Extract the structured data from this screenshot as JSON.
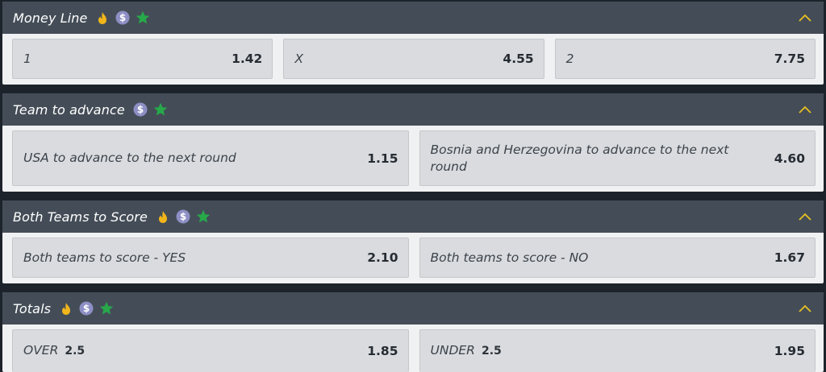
{
  "markets": [
    {
      "title": "Money Line",
      "outcomes": [
        {
          "label": "1",
          "odds": "1.42"
        },
        {
          "label": "X",
          "odds": "4.55"
        },
        {
          "label": "2",
          "odds": "7.75"
        }
      ]
    },
    {
      "title": "Team to advance",
      "outcomes": [
        {
          "label": "USA to advance to the next round",
          "odds": "1.15"
        },
        {
          "label": "Bosnia and Herzegovina to advance to the next round",
          "odds": "4.60"
        }
      ]
    },
    {
      "title": "Both Teams to Score",
      "outcomes": [
        {
          "label": "Both teams to score - YES",
          "odds": "2.10"
        },
        {
          "label": "Both teams to score - NO",
          "odds": "1.67"
        }
      ]
    },
    {
      "title": "Totals",
      "outcomes": [
        {
          "label": "OVER",
          "line": "2.5",
          "odds": "1.85"
        },
        {
          "label": "UNDER",
          "line": "2.5",
          "odds": "1.95"
        }
      ]
    }
  ],
  "icons": {
    "fire": "fire-icon",
    "dollar": "dollar-icon",
    "star": "star-icon",
    "collapse": "chevron-up-icon"
  },
  "colors": {
    "background": "#1d232b",
    "header": "#444d57",
    "panel": "#f0f1f2",
    "outcome": "#d9dbde",
    "fire": "#f0b51b",
    "dollar": "#8d8fc4",
    "star": "#27a84a",
    "chevron": "#e8c020"
  }
}
